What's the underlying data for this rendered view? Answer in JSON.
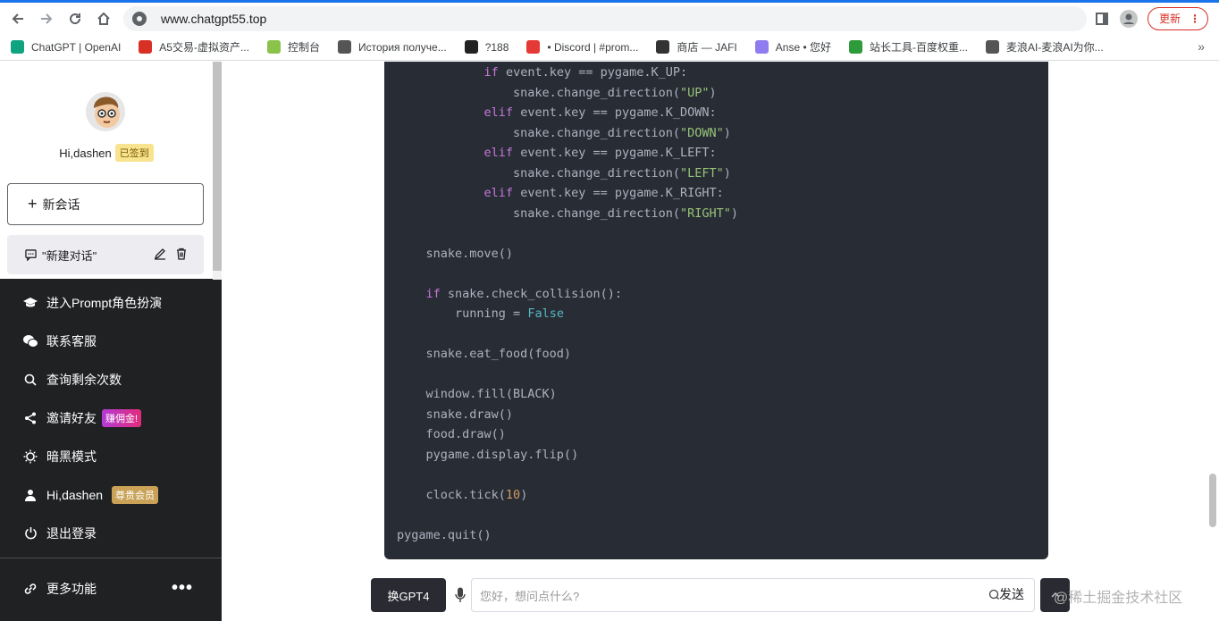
{
  "browser": {
    "url": "www.chatgpt55.top",
    "update_label": "更新",
    "bookmarks": [
      {
        "label": "ChatGPT | OpenAI",
        "color": "#10a37f"
      },
      {
        "label": "A5交易-虚拟资产...",
        "color": "#d93025"
      },
      {
        "label": "控制台",
        "color": "#8bc34a"
      },
      {
        "label": "История получе...",
        "color": "#555555"
      },
      {
        "label": "?188",
        "color": "#222222"
      },
      {
        "label": "• Discord | #prom...",
        "color": "#e53935"
      },
      {
        "label": "商店 — JAFI",
        "color": "#333333"
      },
      {
        "label": "Anse • 您好",
        "color": "#8e7cf0"
      },
      {
        "label": "站长工具-百度权重...",
        "color": "#2e9b3a"
      },
      {
        "label": "麦浪AI-麦浪AI为你...",
        "color": "#555555"
      }
    ],
    "bookmarks_more": "»"
  },
  "sidebar": {
    "greeting": "Hi,dashen",
    "signed_badge": "已签到",
    "new_chat_label": "新会话",
    "chat_item_label": "\"新建对话\"",
    "menu": {
      "prompt": "进入Prompt角色扮演",
      "service": "联系客服",
      "query": "查询剩余次数",
      "invite": "邀请好友",
      "invite_badge": "赚佣金!",
      "dark": "暗黑模式",
      "user": "Hi,dashen",
      "vip_badge": "尊贵会员",
      "logout": "退出登录"
    },
    "more_label": "更多功能",
    "more_dots": "•••"
  },
  "code": {
    "l1": [
      "            ",
      "if",
      " event.key == pygame.K_UP:"
    ],
    "l2": [
      "                snake.change_direction(",
      "\"UP\"",
      ")"
    ],
    "l3": [
      "            ",
      "elif",
      " event.key == pygame.K_DOWN:"
    ],
    "l4": [
      "                snake.change_direction(",
      "\"DOWN\"",
      ")"
    ],
    "l5": [
      "            ",
      "elif",
      " event.key == pygame.K_LEFT:"
    ],
    "l6": [
      "                snake.change_direction(",
      "\"LEFT\"",
      ")"
    ],
    "l7": [
      "            ",
      "elif",
      " event.key == pygame.K_RIGHT:"
    ],
    "l8": [
      "                snake.change_direction(",
      "\"RIGHT\"",
      ")"
    ],
    "l10": "    snake.move()",
    "l12": [
      "    ",
      "if",
      " snake.check_collision():"
    ],
    "l13": [
      "        running = ",
      "False"
    ],
    "l15": "    snake.eat_food(food)",
    "l17": "    window.fill(BLACK)",
    "l18": "    snake.draw()",
    "l19": "    food.draw()",
    "l20": "    pygame.display.flip()",
    "l22": [
      "    clock.tick(",
      "10",
      ")"
    ],
    "l24": "pygame.quit()"
  },
  "input": {
    "gpt_button": "换GPT4",
    "placeholder": "您好，想问点什么?",
    "send_label": "发送",
    "watermark": "@稀土掘金技术社区"
  }
}
